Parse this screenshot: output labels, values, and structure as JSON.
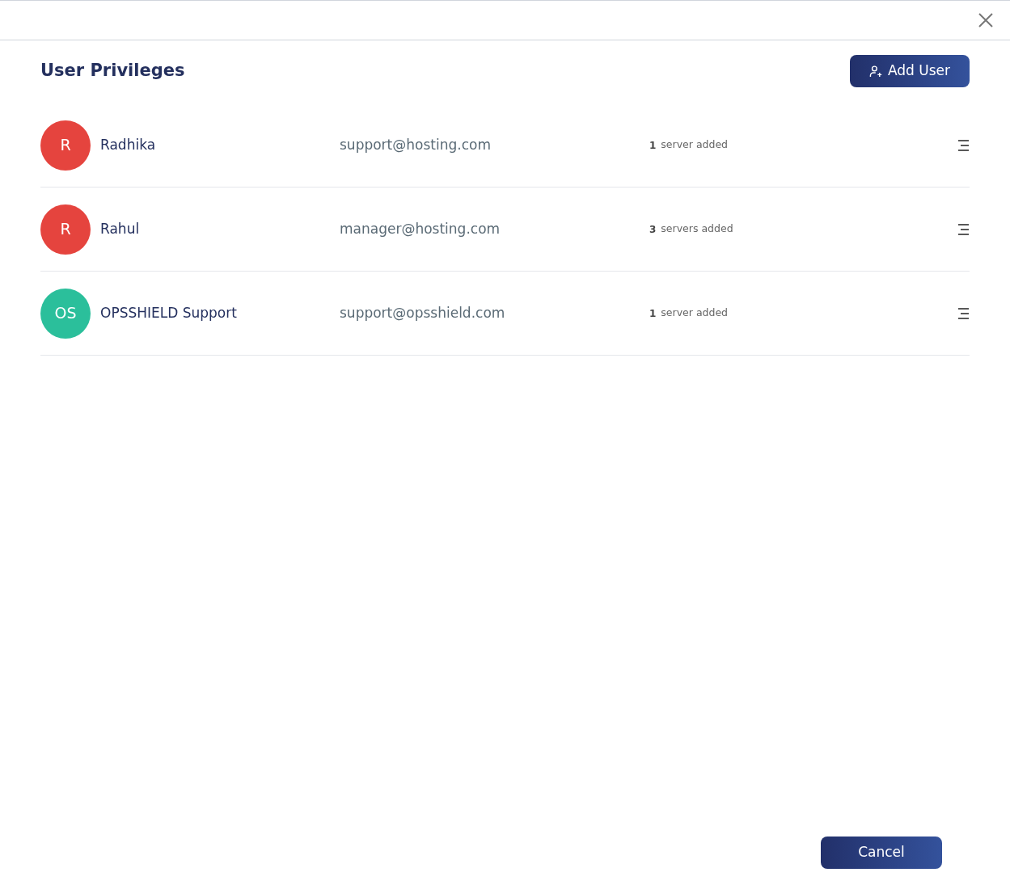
{
  "dialog": {
    "title": "User Privileges",
    "add_button": "Add User",
    "cancel_button": "Cancel"
  },
  "users": [
    {
      "initials": "R",
      "color": "#e5443e",
      "name": "Radhika",
      "email": "support@hosting.com",
      "count": "1",
      "count_label": "server added"
    },
    {
      "initials": "R",
      "color": "#e5443e",
      "name": "Rahul",
      "email": "manager@hosting.com",
      "count": "3",
      "count_label": "servers added"
    },
    {
      "initials": "OS",
      "color": "#2bbf9b",
      "name": "OPSSHIELD Support",
      "email": "support@opsshield.com",
      "count": "1",
      "count_label": "server added"
    }
  ]
}
